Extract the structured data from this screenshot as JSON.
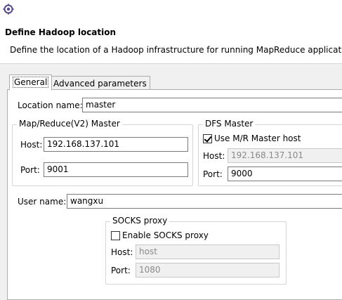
{
  "window": {
    "icon": "gear-icon"
  },
  "header": {
    "title": "Define Hadoop location",
    "description": "Define the location of a Hadoop infrastructure for running MapReduce applicatio"
  },
  "tabs": [
    {
      "label": "General",
      "active": true
    },
    {
      "label": "Advanced parameters",
      "active": false
    }
  ],
  "general": {
    "location_name": {
      "label": "Location name:",
      "value": "master"
    },
    "mr_master": {
      "title": "Map/Reduce(V2) Master",
      "host_label": "Host:",
      "host_value": "192.168.137.101",
      "port_label": "Port:",
      "port_value": "9001"
    },
    "dfs_master": {
      "title": "DFS Master",
      "use_mr_label": "Use M/R Master host",
      "use_mr_checked": true,
      "host_label": "Host:",
      "host_value": "192.168.137.101",
      "port_label": "Port:",
      "port_value": "9000"
    },
    "user_name": {
      "label": "User name:",
      "value": "wangxu"
    },
    "socks_proxy": {
      "title": "SOCKS proxy",
      "enable_label": "Enable SOCKS proxy",
      "enable_checked": false,
      "host_label": "Host:",
      "host_value": "host",
      "port_label": "Port:",
      "port_value": "1080"
    }
  }
}
